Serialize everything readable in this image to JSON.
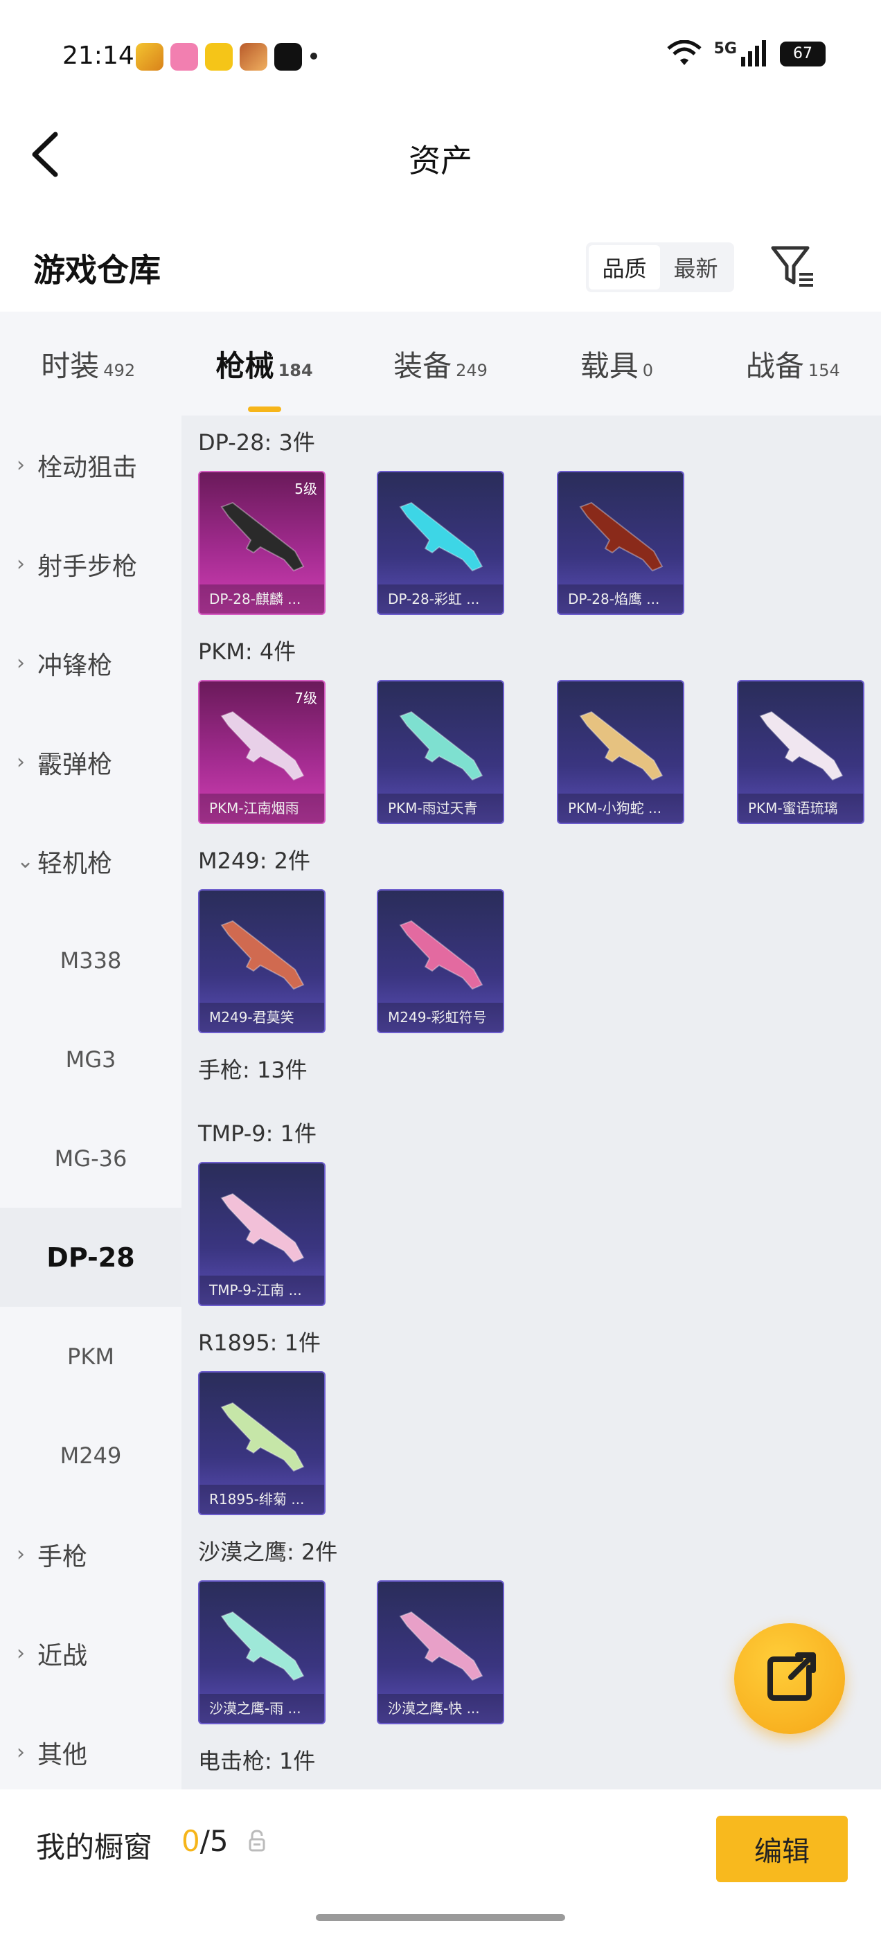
{
  "status": {
    "time": "21:14",
    "network": "5G",
    "battery": "67"
  },
  "nav": {
    "title": "资产"
  },
  "section": {
    "title": "游戏仓库",
    "seg_quality": "品质",
    "seg_latest": "最新"
  },
  "tabs": [
    {
      "label": "时装",
      "count": "492"
    },
    {
      "label": "枪械",
      "count": "184"
    },
    {
      "label": "装备",
      "count": "249"
    },
    {
      "label": "载具",
      "count": "0"
    },
    {
      "label": "战备",
      "count": "154"
    }
  ],
  "sidebar": [
    {
      "label": "栓动狙击"
    },
    {
      "label": "射手步枪"
    },
    {
      "label": "冲锋枪"
    },
    {
      "label": "霰弹枪"
    },
    {
      "label": "轻机枪"
    },
    {
      "label": "M338"
    },
    {
      "label": "MG3"
    },
    {
      "label": "MG-36"
    },
    {
      "label": "DP-28"
    },
    {
      "label": "PKM"
    },
    {
      "label": "M249"
    },
    {
      "label": "手枪"
    },
    {
      "label": "近战"
    },
    {
      "label": "其他"
    }
  ],
  "groups": [
    {
      "label": "DP-28: 3件",
      "items": [
        {
          "name": "DP-28-麒麟 ...",
          "level": "5级",
          "style": "pink",
          "color": "#2a2a2a"
        },
        {
          "name": "DP-28-彩虹 ...",
          "level": "",
          "style": "blue",
          "color": "#3dd6e6"
        },
        {
          "name": "DP-28-焰鹰 ...",
          "level": "",
          "style": "blue",
          "color": "#8a2a1a"
        }
      ]
    },
    {
      "label": "PKM: 4件",
      "items": [
        {
          "name": "PKM-江南烟雨",
          "level": "7级",
          "style": "pink",
          "color": "#e8d0e8"
        },
        {
          "name": "PKM-雨过天青",
          "level": "",
          "style": "blue",
          "color": "#7ee0d0"
        },
        {
          "name": "PKM-小狗蛇 ...",
          "level": "",
          "style": "blue",
          "color": "#e6c280"
        },
        {
          "name": "PKM-蜜语琉璃",
          "level": "",
          "style": "blue",
          "color": "#f0e6f0"
        }
      ]
    },
    {
      "label": "M249: 2件",
      "items": [
        {
          "name": "M249-君莫笑",
          "level": "",
          "style": "blue",
          "color": "#d06a50"
        },
        {
          "name": "M249-彩虹符号",
          "level": "",
          "style": "blue",
          "color": "#e36aa0"
        }
      ]
    },
    {
      "label": "手枪: 13件",
      "items": []
    },
    {
      "label": "TMP-9: 1件",
      "items": [
        {
          "name": "TMP-9-江南 ...",
          "level": "",
          "style": "blue",
          "color": "#f2c0d8"
        }
      ]
    },
    {
      "label": "R1895: 1件",
      "items": [
        {
          "name": "R1895-绯菊 ...",
          "level": "",
          "style": "blue",
          "color": "#c6e6a8"
        }
      ]
    },
    {
      "label": "沙漠之鹰: 2件",
      "items": [
        {
          "name": "沙漠之鹰-雨 ...",
          "level": "",
          "style": "blue",
          "color": "#9ee8d8"
        },
        {
          "name": "沙漠之鹰-快 ...",
          "level": "",
          "style": "blue",
          "color": "#e8a0c8"
        }
      ]
    },
    {
      "label": "电击枪: 1件",
      "items": []
    }
  ],
  "bottom": {
    "label": "我的橱窗",
    "current": "0",
    "total": "/5",
    "edit": "编辑"
  },
  "colors": {
    "accent": "#f6b51a",
    "card_blue": "#3a3580",
    "card_pink": "#a22b8f"
  }
}
